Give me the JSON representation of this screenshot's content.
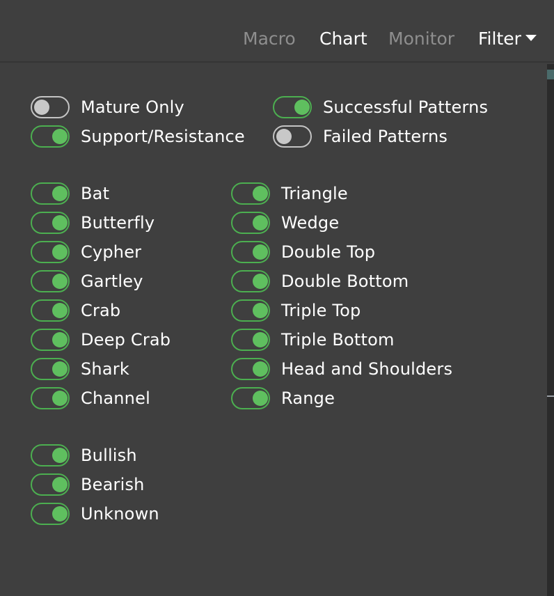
{
  "nav": {
    "macro": "Macro",
    "chart": "Chart",
    "monitor": "Monitor",
    "filter": "Filter"
  },
  "options": {
    "mature_only": {
      "label": "Mature Only",
      "on": false
    },
    "support_resistance": {
      "label": "Support/Resistance",
      "on": true
    },
    "successful_patterns": {
      "label": "Successful Patterns",
      "on": true
    },
    "failed_patterns": {
      "label": "Failed Patterns",
      "on": false
    }
  },
  "harmonic_patterns": [
    {
      "label": "Bat",
      "on": true
    },
    {
      "label": "Butterfly",
      "on": true
    },
    {
      "label": "Cypher",
      "on": true
    },
    {
      "label": "Gartley",
      "on": true
    },
    {
      "label": "Crab",
      "on": true
    },
    {
      "label": "Deep Crab",
      "on": true
    },
    {
      "label": "Shark",
      "on": true
    },
    {
      "label": "Channel",
      "on": true
    }
  ],
  "chart_patterns": [
    {
      "label": "Triangle",
      "on": true
    },
    {
      "label": "Wedge",
      "on": true
    },
    {
      "label": "Double Top",
      "on": true
    },
    {
      "label": "Double Bottom",
      "on": true
    },
    {
      "label": "Triple Top",
      "on": true
    },
    {
      "label": "Triple Bottom",
      "on": true
    },
    {
      "label": "Head and Shoulders",
      "on": true
    },
    {
      "label": "Range",
      "on": true
    }
  ],
  "directions": [
    {
      "label": "Bullish",
      "on": true
    },
    {
      "label": "Bearish",
      "on": true
    },
    {
      "label": "Unknown",
      "on": true
    }
  ]
}
